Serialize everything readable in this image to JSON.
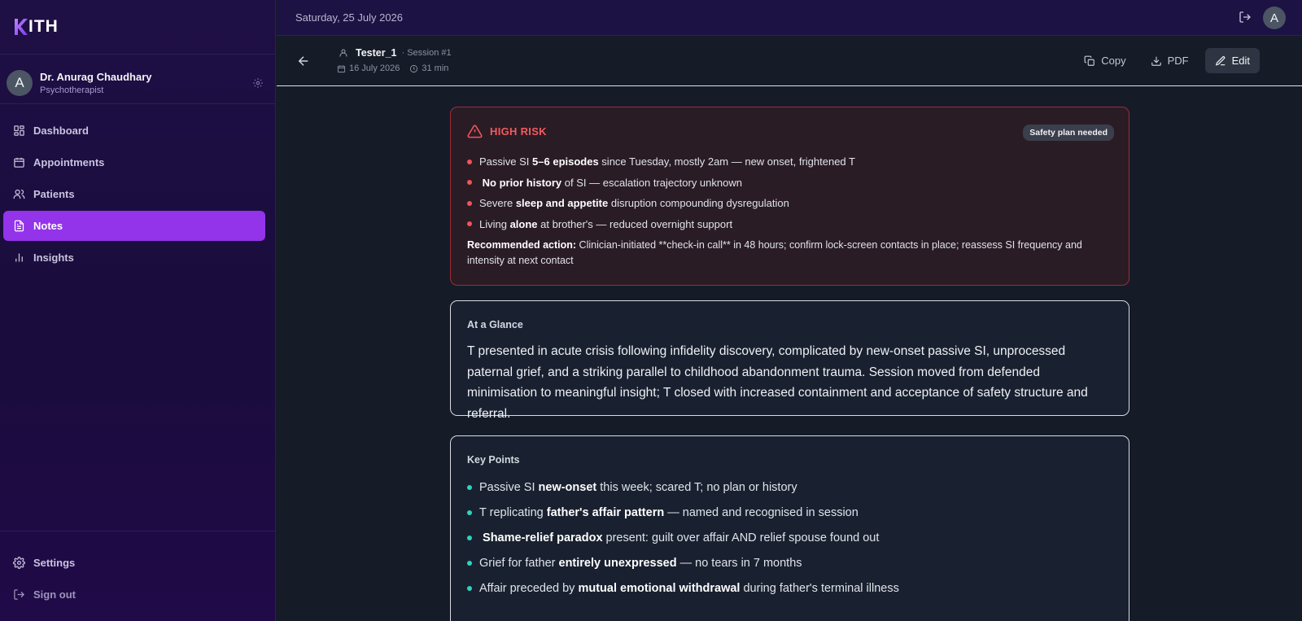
{
  "app": {
    "logo_text": "ITH"
  },
  "user": {
    "initial": "A",
    "name": "Dr. Anurag Chaudhary",
    "role": "Psychotherapist"
  },
  "nav": {
    "items": [
      {
        "label": "Dashboard",
        "icon": "dashboard-icon"
      },
      {
        "label": "Appointments",
        "icon": "calendar-icon"
      },
      {
        "label": "Patients",
        "icon": "users-icon"
      },
      {
        "label": "Notes",
        "icon": "note-icon",
        "active": true
      },
      {
        "label": "Insights",
        "icon": "bar-chart-icon"
      }
    ],
    "bottom": [
      {
        "label": "Settings",
        "icon": "gear-icon"
      },
      {
        "label": "Sign out",
        "icon": "logout-icon"
      }
    ]
  },
  "topbar": {
    "date": "Saturday, 25 July 2026",
    "avatar_initial": "A"
  },
  "session": {
    "patient": "Tester_1",
    "session_label": "· Session #1",
    "date": "16 July 2026",
    "duration": "31 min"
  },
  "actions": {
    "copy": "Copy",
    "pdf": "PDF",
    "edit": "Edit"
  },
  "risk": {
    "title": "HIGH RISK",
    "badge": "Safety plan needed",
    "bullets": [
      {
        "pre": "Passive SI ",
        "bold": "5–6 episodes",
        "post": " since Tuesday, mostly 2am — new onset, frightened T"
      },
      {
        "pre": " ",
        "bold": "No prior history",
        "post": " of SI — escalation trajectory unknown"
      },
      {
        "pre": "Severe ",
        "bold": "sleep and appetite",
        "post": " disruption compounding dysregulation"
      },
      {
        "pre": "Living ",
        "bold": "alone",
        "post": " at brother's — reduced overnight support"
      }
    ],
    "recommended_label": "Recommended action:",
    "recommended_text": " Clinician-initiated **check-in call** in 48 hours; confirm lock-screen contacts in place; reassess SI frequency and intensity at next contact"
  },
  "glance": {
    "label": "At a Glance",
    "text": "T presented in acute crisis following infidelity discovery, complicated by new-onset passive SI, unprocessed paternal grief, and a striking parallel to childhood abandonment trauma. Session moved from defended minimisation to meaningful insight; T closed with increased containment and acceptance of safety structure and referral."
  },
  "key_points": {
    "label": "Key Points",
    "bullets": [
      {
        "pre": "Passive SI ",
        "bold": "new-onset",
        "post": " this week; scared T; no plan or history"
      },
      {
        "pre": "T replicating ",
        "bold": "father's affair pattern",
        "post": " — named and recognised in session"
      },
      {
        "pre": " ",
        "bold": "Shame-relief paradox",
        "post": " present: guilt over affair AND relief spouse found out"
      },
      {
        "pre": "Grief for father ",
        "bold": "entirely unexpressed",
        "post": " — no tears in 7 months"
      },
      {
        "pre": "Affair preceded by ",
        "bold": "mutual emotional withdrawal",
        "post": " during father's terminal illness"
      }
    ]
  },
  "colors": {
    "accent": "#9333ea",
    "risk_red": "#f2545b",
    "teal": "#2dd4bf",
    "sidebar_bg": "#1e0f45",
    "content_bg": "#151b27"
  }
}
